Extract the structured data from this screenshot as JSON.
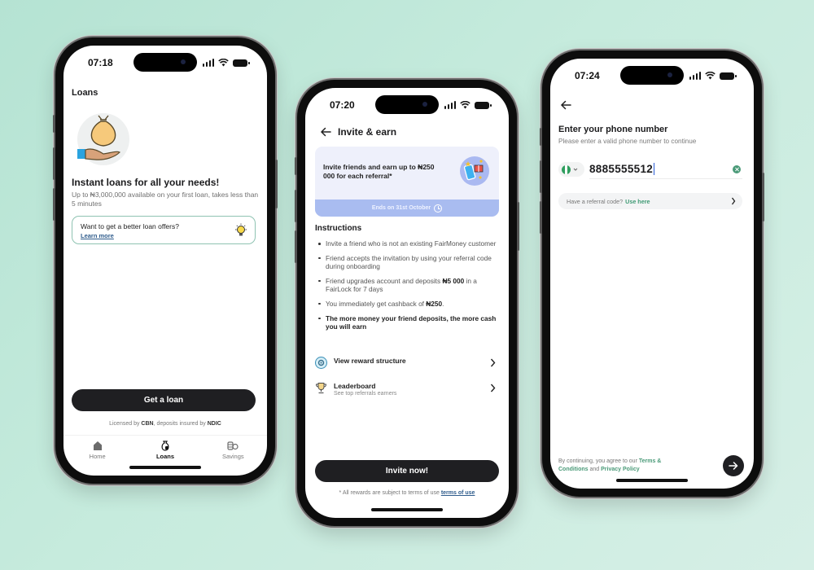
{
  "background": {
    "gradient_start": "#b5e3d3",
    "gradient_end": "#d6efe6"
  },
  "phones": [
    {
      "status": {
        "time": "07:18"
      },
      "title": "Loans",
      "illustration_icon": "money-bag-hand-icon",
      "headline": "Instant loans for all your needs!",
      "subtitle": "Up to ₦3,000,000 available on your first loan, takes less than 5 minutes",
      "offer_card": {
        "text": "Want to get a better loan offers?",
        "link": "Learn more",
        "icon": "lightbulb-icon",
        "border_color": "#8fc3b2"
      },
      "cta": "Get a loan",
      "license": {
        "prefix": "Licensed by ",
        "cbn": "CBN",
        "middle": ", deposits insured by ",
        "ndic": "NDIC"
      },
      "tabs": [
        {
          "label": "Home",
          "icon": "home-icon",
          "active": false
        },
        {
          "label": "Loans",
          "icon": "loan-bag-icon",
          "active": true
        },
        {
          "label": "Savings",
          "icon": "savings-coins-icon",
          "active": false
        }
      ]
    },
    {
      "status": {
        "time": "07:20"
      },
      "title": "Invite & earn",
      "banner": {
        "text": "Invite friends and earn up to ₦250 000 for each referral*",
        "footer": "Ends on 31st October",
        "icon": "phone-gift-icon",
        "bg_color": "#eef0fb",
        "footer_color": "#a9bcf0"
      },
      "instructions_title": "Instructions",
      "instructions": [
        {
          "text": "Invite a friend who is not an existing FairMoney customer"
        },
        {
          "text": "Friend accepts the invitation by using your referral code during onboarding"
        },
        {
          "pre": "Friend upgrades account and deposits ",
          "bold": "₦5 000",
          "post": " in a FairLock for 7 days"
        },
        {
          "pre": "You immediately get cashback of ",
          "bold": "₦250",
          "post": "."
        },
        {
          "text": "The more money your friend deposits, the more cash you will earn",
          "emphasis": true
        }
      ],
      "rows": [
        {
          "label": "View reward structure",
          "icon": "gear-badge-icon"
        },
        {
          "label": "Leaderboard",
          "sub": "See top referrals earners",
          "icon": "trophy-icon"
        }
      ],
      "cta": "Invite now!",
      "terms": {
        "text": "* All rewards are subject to terms of use",
        "link": "terms of use"
      }
    },
    {
      "status": {
        "time": "07:24"
      },
      "title": "Enter your phone number",
      "subtitle": "Please enter a valid phone number to continue",
      "country": {
        "flag": "nigeria-flag-icon",
        "colors": [
          "#2f9e5e",
          "#ffffff",
          "#2f9e5e"
        ]
      },
      "phone_value": "8885555512",
      "referral": {
        "text": "Have a referral code?",
        "link": "Use here"
      },
      "consent": {
        "prefix": "By continuing, you agree to our ",
        "terms": "Terms & Conditions",
        "middle": " and ",
        "privacy": "Privacy Policy"
      },
      "accent_color": "#4a9a78"
    }
  ]
}
